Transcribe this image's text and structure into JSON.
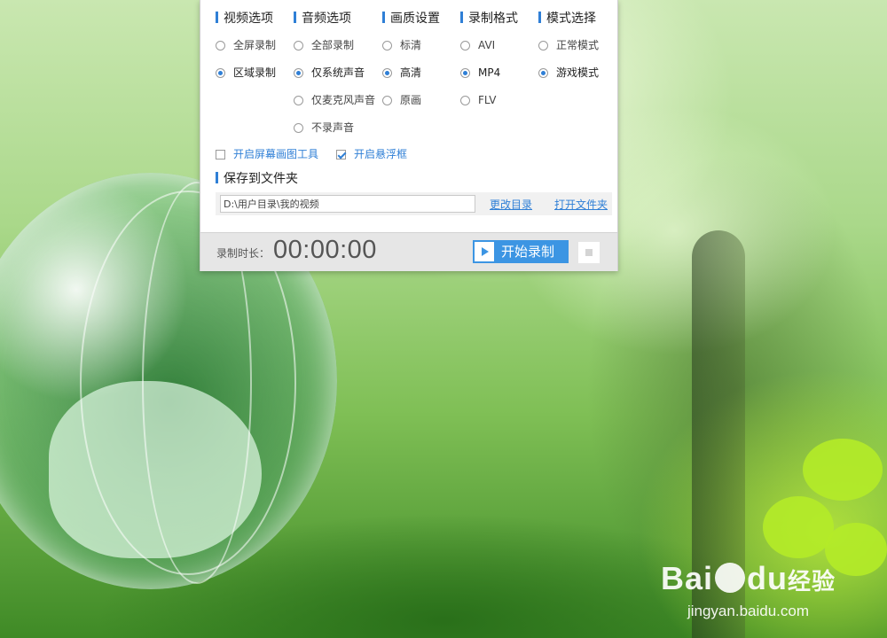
{
  "sections": [
    {
      "title": "视频选项",
      "options": [
        {
          "label": "全屏录制",
          "checked": false
        },
        {
          "label": "区域录制",
          "checked": true
        }
      ]
    },
    {
      "title": "音频选项",
      "options": [
        {
          "label": "全部录制",
          "checked": false
        },
        {
          "label": "仅系统声音",
          "checked": true
        },
        {
          "label": "仅麦克风声音",
          "checked": false
        },
        {
          "label": "不录声音",
          "checked": false
        }
      ]
    },
    {
      "title": "画质设置",
      "options": [
        {
          "label": "标清",
          "checked": false
        },
        {
          "label": "高清",
          "checked": true
        },
        {
          "label": "原画",
          "checked": false
        }
      ]
    },
    {
      "title": "录制格式",
      "options": [
        {
          "label": "AVI",
          "checked": false
        },
        {
          "label": "MP4",
          "checked": true
        },
        {
          "label": "FLV",
          "checked": false
        }
      ]
    },
    {
      "title": "模式选择",
      "options": [
        {
          "label": "正常模式",
          "checked": false
        },
        {
          "label": "游戏模式",
          "checked": true
        }
      ]
    }
  ],
  "checkboxes": [
    {
      "label": "开启屏幕画图工具",
      "checked": false
    },
    {
      "label": "开启悬浮框",
      "checked": true
    }
  ],
  "save": {
    "title": "保存到文件夹",
    "path": "D:\\用户目录\\我的视频",
    "change_dir": "更改目录",
    "open_folder": "打开文件夹"
  },
  "footer": {
    "duration_label": "录制时长：",
    "duration": "00:00:00",
    "start_label": "开始录制"
  },
  "watermark": {
    "logo_left": "Bai",
    "logo_mid": "du",
    "logo_right": "经验",
    "url": "jingyan.baidu.com"
  },
  "colors": {
    "accent": "#3c95e3",
    "link": "#2f7fd6"
  }
}
